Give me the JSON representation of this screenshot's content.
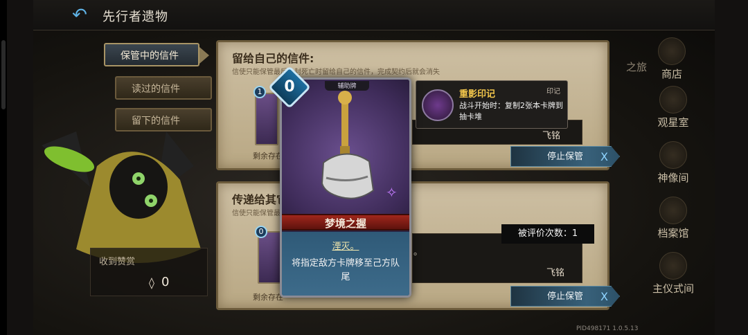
{
  "header": {
    "title": "先行者遗物"
  },
  "tabs": [
    {
      "label": "保管中的信件",
      "active": true
    },
    {
      "label": "读过的信件",
      "active": false
    },
    {
      "label": "留下的信件",
      "active": false
    }
  ],
  "panel_self": {
    "title": "留给自己的信件:",
    "subtitle": "信使只能保管最后一封死亡时留给自己的信件，完成契约后就会消失",
    "remaining": "剩余存在",
    "signer": "飞铭",
    "stop_label": "停止保管"
  },
  "panel_others": {
    "title": "传递给其它",
    "subtitle": "信使只能保管最",
    "remaining": "剩余存在",
    "snippet": "。",
    "signer": "飞铭",
    "stop_label": "停止保管"
  },
  "reward": {
    "label": "收到赞赏",
    "icon": "feather-diamond-icon",
    "value": "0"
  },
  "nav": [
    {
      "label": "商店",
      "partial": "之旅"
    },
    {
      "label": "观星室"
    },
    {
      "label": "神像间"
    },
    {
      "label": "档案馆"
    },
    {
      "label": "主仪式间"
    }
  ],
  "card": {
    "cost": "0",
    "type": "辅助牌",
    "name": "梦境之握",
    "keyword": "湮灭。",
    "text": "将指定敌方卡牌移至己方队尾",
    "art": "gauntlet-with-staff"
  },
  "tooltip": {
    "title": "重影印记",
    "tag": "印记",
    "text": "战斗开始时：复制2张本卡牌到抽卡堆"
  },
  "rating": {
    "text": "被评价次数：1"
  },
  "footer": {
    "pid": "PID498171  1.0.5.13"
  },
  "mini_cards": [
    "1",
    "0"
  ],
  "colors": {
    "accent_blue": "#38617a",
    "card_name_red": "#a0271c",
    "tooltip_gold": "#f2c64b"
  }
}
